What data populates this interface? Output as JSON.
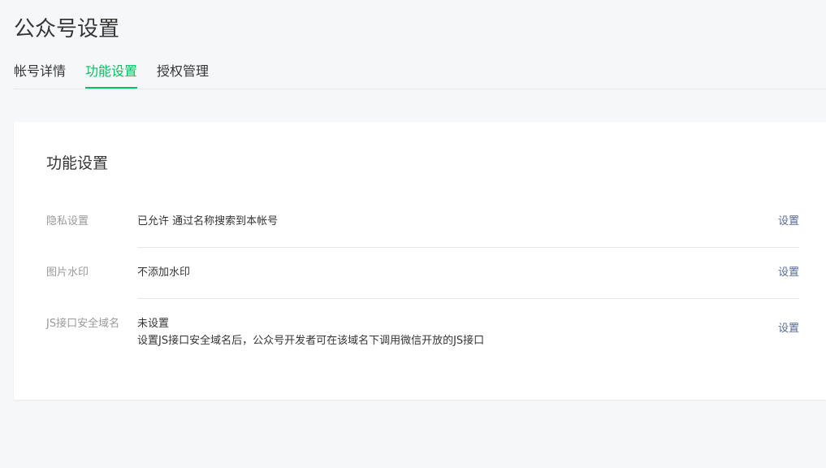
{
  "header": {
    "title": "公众号设置"
  },
  "tabs": [
    {
      "label": "帐号详情",
      "active": false
    },
    {
      "label": "功能设置",
      "active": true
    },
    {
      "label": "授权管理",
      "active": false
    }
  ],
  "section": {
    "title": "功能设置",
    "rows": [
      {
        "label": "隐私设置",
        "value": "已允许 通过名称搜索到本帐号",
        "action": "设置"
      },
      {
        "label": "图片水印",
        "value": "不添加水印",
        "action": "设置"
      },
      {
        "label": "JS接口安全域名",
        "value": "未设置",
        "description": "设置JS接口安全域名后，公众号开发者可在该域名下调用微信开放的JS接口",
        "action": "设置"
      }
    ]
  },
  "colors": {
    "accent": "#07c160",
    "link": "#576b95",
    "muted": "#9a9a9a",
    "background": "#f6f7f9"
  }
}
